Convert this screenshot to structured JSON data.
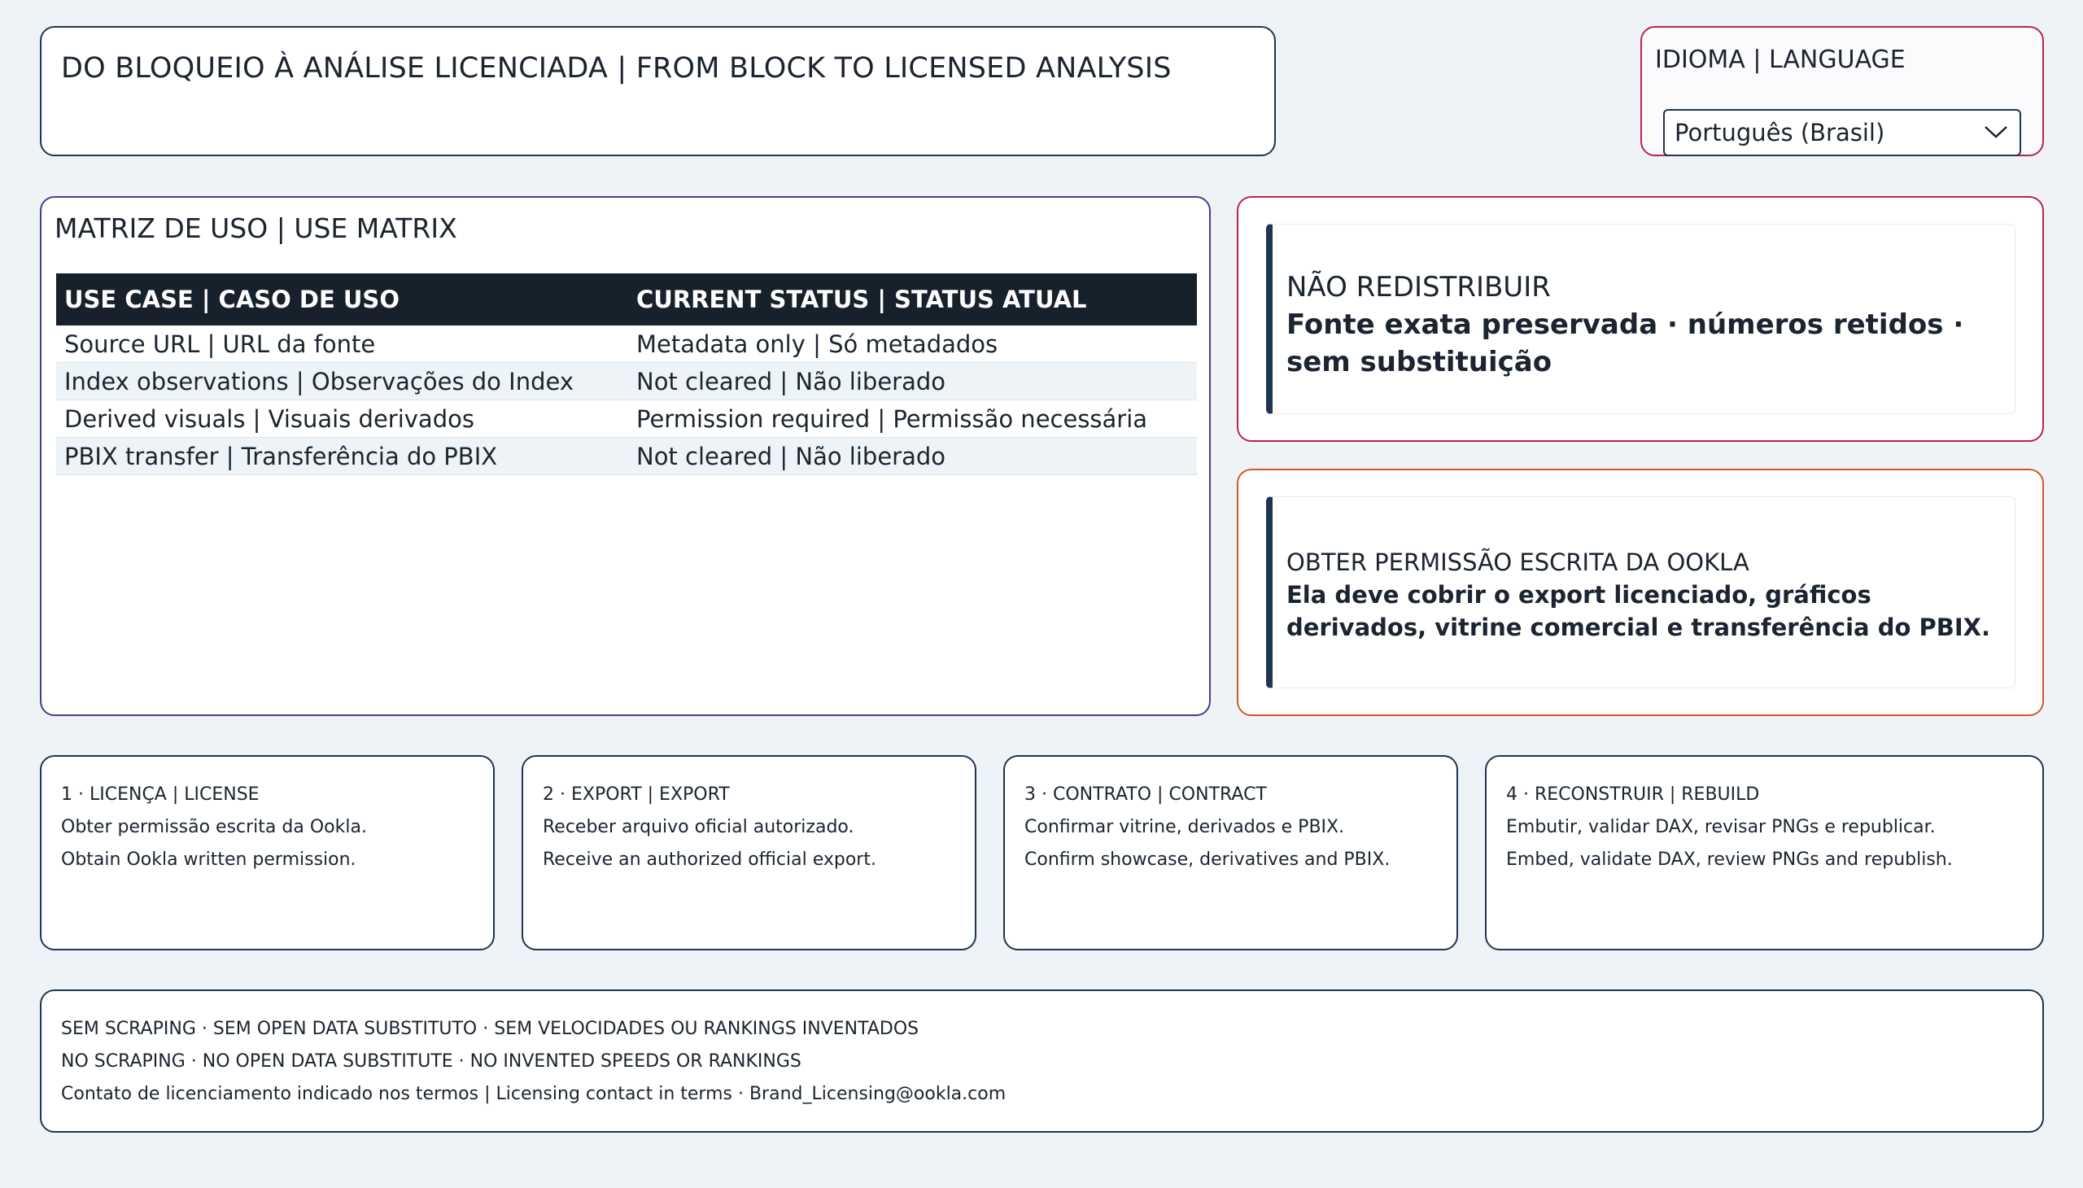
{
  "header": {
    "title": "DO BLOQUEIO À ANÁLISE LICENCIADA | FROM BLOCK TO LICENSED ANALYSIS"
  },
  "language": {
    "label": "IDIOMA | LANGUAGE",
    "selected": "Português (Brasil)"
  },
  "matrix": {
    "title": "MATRIZ DE USO | USE MATRIX",
    "columns": [
      "USE CASE | CASO DE USO",
      "CURRENT STATUS | STATUS ATUAL"
    ],
    "rows": [
      [
        "Source URL | URL da fonte",
        "Metadata only | Só metadados"
      ],
      [
        "Index observations | Observações do Index",
        "Not cleared | Não liberado"
      ],
      [
        "Derived visuals | Visuais derivados",
        "Permission required | Permissão necessária"
      ],
      [
        "PBIX transfer | Transferência do PBIX",
        "Not cleared | Não liberado"
      ]
    ]
  },
  "notice1": {
    "head": "NÃO REDISTRIBUIR",
    "body": "Fonte exata preservada · números retidos · sem substituição"
  },
  "notice2": {
    "head": "OBTER PERMISSÃO ESCRITA DA OOKLA",
    "body": "Ela deve cobrir o export licenciado, gráficos derivados, vitrine comercial e transferência do PBIX."
  },
  "steps": [
    {
      "title": "1 · LICENÇA | LICENSE",
      "pt": "Obter permissão escrita da Ookla.",
      "en": "Obtain Ookla written permission."
    },
    {
      "title": "2 · EXPORT | EXPORT",
      "pt": "Receber arquivo oficial autorizado.",
      "en": "Receive an authorized official export."
    },
    {
      "title": "3 · CONTRATO | CONTRACT",
      "pt": "Confirmar vitrine, derivados e PBIX.",
      "en": "Confirm showcase, derivatives and PBIX."
    },
    {
      "title": "4 · RECONSTRUIR | REBUILD",
      "pt": "Embutir, validar DAX, revisar PNGs e republicar.",
      "en": "Embed, validate DAX, review PNGs and republish."
    }
  ],
  "footer": {
    "line1": "SEM SCRAPING · SEM OPEN DATA SUBSTITUTO · SEM VELOCIDADES OU RANKINGS INVENTADOS",
    "line2": "NO SCRAPING · NO OPEN DATA SUBSTITUTE · NO INVENTED SPEEDS OR RANKINGS",
    "line3": "Contato de licenciamento indicado nos termos | Licensing contact in terms · Brand_Licensing@ookla.com"
  },
  "colors": {
    "navy": "#1f3550",
    "crimson": "#b9244a",
    "orange": "#d1562a",
    "purple": "#4b3d86",
    "table_header": "#17212c",
    "background": "#eef3f8"
  },
  "icons": {
    "language_dropdown": "chevron-down-icon"
  }
}
